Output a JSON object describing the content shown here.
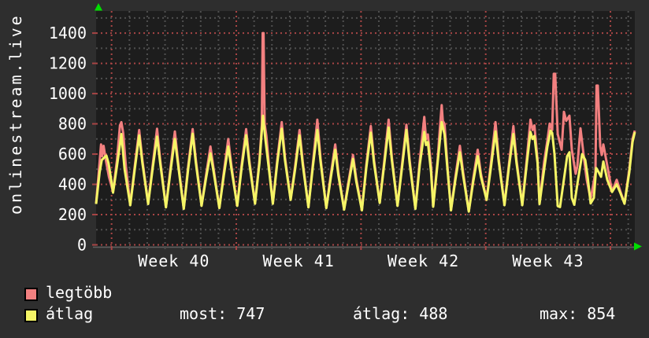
{
  "title": "onlinestream.live",
  "colors": {
    "background": "#2e2e2e",
    "plot_background": "#1d1d1d",
    "grid_major": "#a84545",
    "grid_minor": "#4f4f4f",
    "axis_line": "#606060",
    "arrow_green": "#00dd00",
    "text": "#ffffff",
    "series_max": "#f28080",
    "series_avg": "#f5f566",
    "swatch_border": "#000000"
  },
  "chart_data": {
    "type": "line",
    "title": "onlinestream.live",
    "x_axis": {
      "labels": [
        "Week 40",
        "Week 41",
        "Week 42",
        "Week 43"
      ],
      "unit": "days",
      "range_days": [
        0,
        30.24
      ],
      "week_major_ticks_days": [
        0.87,
        7.87,
        14.87,
        21.87,
        28.87
      ],
      "minor_tick_every_days": 1,
      "label_midpoints_days": [
        4.37,
        11.37,
        18.37,
        25.37
      ]
    },
    "y_axis": {
      "min": 0,
      "max": 1550,
      "major_step": 200,
      "minor_step": 100,
      "tick_labels": [
        0,
        200,
        400,
        600,
        800,
        1000,
        1200,
        1400
      ]
    },
    "grid": true,
    "legend_position": "bottom-left",
    "series": [
      {
        "name": "legtöbb",
        "color": "#f28080",
        "points": [
          [
            0,
            274
          ],
          [
            0.2,
            550
          ],
          [
            0.28,
            664
          ],
          [
            0.34,
            586
          ],
          [
            0.42,
            655
          ],
          [
            0.55,
            560
          ],
          [
            0.72,
            450
          ],
          [
            0.95,
            352
          ],
          [
            1.17,
            560
          ],
          [
            1.34,
            790
          ],
          [
            1.42,
            811
          ],
          [
            1.52,
            740
          ],
          [
            1.67,
            520
          ],
          [
            1.92,
            265
          ],
          [
            2.17,
            520
          ],
          [
            2.42,
            759
          ],
          [
            2.6,
            560
          ],
          [
            2.92,
            274
          ],
          [
            3.17,
            520
          ],
          [
            3.42,
            768
          ],
          [
            3.6,
            560
          ],
          [
            3.92,
            250
          ],
          [
            4.17,
            500
          ],
          [
            4.42,
            750
          ],
          [
            4.6,
            550
          ],
          [
            4.92,
            240
          ],
          [
            5.17,
            520
          ],
          [
            5.42,
            765
          ],
          [
            5.6,
            560
          ],
          [
            5.92,
            260
          ],
          [
            6.17,
            460
          ],
          [
            6.42,
            650
          ],
          [
            6.6,
            500
          ],
          [
            6.92,
            245
          ],
          [
            7.17,
            480
          ],
          [
            7.42,
            700
          ],
          [
            7.6,
            520
          ],
          [
            7.92,
            260
          ],
          [
            8.17,
            530
          ],
          [
            8.42,
            765
          ],
          [
            8.6,
            560
          ],
          [
            8.92,
            275
          ],
          [
            9.17,
            560
          ],
          [
            9.3,
            790
          ],
          [
            9.35,
            1400
          ],
          [
            9.4,
            1400
          ],
          [
            9.46,
            800
          ],
          [
            9.56,
            720
          ],
          [
            9.72,
            500
          ],
          [
            9.92,
            275
          ],
          [
            10.17,
            560
          ],
          [
            10.42,
            811
          ],
          [
            10.6,
            580
          ],
          [
            10.92,
            300
          ],
          [
            11.17,
            520
          ],
          [
            11.42,
            759
          ],
          [
            11.6,
            550
          ],
          [
            11.92,
            250
          ],
          [
            12.17,
            540
          ],
          [
            12.42,
            828
          ],
          [
            12.6,
            570
          ],
          [
            12.92,
            245
          ],
          [
            13.17,
            460
          ],
          [
            13.42,
            664
          ],
          [
            13.6,
            480
          ],
          [
            13.92,
            235
          ],
          [
            14.17,
            420
          ],
          [
            14.42,
            594
          ],
          [
            14.6,
            440
          ],
          [
            14.92,
            230
          ],
          [
            15.17,
            530
          ],
          [
            15.42,
            785
          ],
          [
            15.6,
            560
          ],
          [
            15.92,
            280
          ],
          [
            16.17,
            550
          ],
          [
            16.42,
            828
          ],
          [
            16.6,
            580
          ],
          [
            16.92,
            260
          ],
          [
            17.17,
            530
          ],
          [
            17.42,
            794
          ],
          [
            17.6,
            560
          ],
          [
            17.92,
            240
          ],
          [
            18.17,
            560
          ],
          [
            18.42,
            846
          ],
          [
            18.52,
            700
          ],
          [
            18.62,
            730
          ],
          [
            18.8,
            520
          ],
          [
            18.92,
            255
          ],
          [
            19.17,
            560
          ],
          [
            19.3,
            780
          ],
          [
            19.4,
            924
          ],
          [
            19.46,
            820
          ],
          [
            19.56,
            800
          ],
          [
            19.72,
            520
          ],
          [
            19.92,
            230
          ],
          [
            20.17,
            450
          ],
          [
            20.42,
            655
          ],
          [
            20.6,
            480
          ],
          [
            20.92,
            222
          ],
          [
            21.17,
            440
          ],
          [
            21.42,
            629
          ],
          [
            21.6,
            470
          ],
          [
            21.92,
            300
          ],
          [
            22.17,
            550
          ],
          [
            22.42,
            811
          ],
          [
            22.6,
            570
          ],
          [
            22.92,
            265
          ],
          [
            23.17,
            530
          ],
          [
            23.42,
            785
          ],
          [
            23.6,
            560
          ],
          [
            23.92,
            265
          ],
          [
            24.17,
            560
          ],
          [
            24.38,
            828
          ],
          [
            24.5,
            760
          ],
          [
            24.6,
            790
          ],
          [
            24.78,
            560
          ],
          [
            24.89,
            276
          ],
          [
            25.15,
            550
          ],
          [
            25.33,
            690
          ],
          [
            25.46,
            802
          ],
          [
            25.6,
            760
          ],
          [
            25.69,
            1131
          ],
          [
            25.77,
            1131
          ],
          [
            25.91,
            733
          ],
          [
            26.13,
            629
          ],
          [
            26.26,
            880
          ],
          [
            26.39,
            820
          ],
          [
            26.57,
            854
          ],
          [
            26.7,
            629
          ],
          [
            26.92,
            470
          ],
          [
            27.01,
            520
          ],
          [
            27.19,
            770
          ],
          [
            27.41,
            550
          ],
          [
            27.54,
            430
          ],
          [
            27.76,
            300
          ],
          [
            28.03,
            480
          ],
          [
            28.09,
            1053
          ],
          [
            28.16,
            1053
          ],
          [
            28.3,
            650
          ],
          [
            28.38,
            594
          ],
          [
            28.47,
            664
          ],
          [
            28.69,
            525
          ],
          [
            28.96,
            352
          ],
          [
            29.22,
            430
          ],
          [
            29.44,
            350
          ],
          [
            29.66,
            274
          ],
          [
            29.93,
            500
          ],
          [
            30.11,
            700
          ],
          [
            30.24,
            755
          ]
        ]
      },
      {
        "name": "átlag",
        "color": "#f5f566",
        "points": [
          [
            0,
            270
          ],
          [
            0.2,
            480
          ],
          [
            0.32,
            560
          ],
          [
            0.45,
            577
          ],
          [
            0.58,
            590
          ],
          [
            0.7,
            540
          ],
          [
            0.85,
            430
          ],
          [
            0.95,
            345
          ],
          [
            1.17,
            520
          ],
          [
            1.42,
            733
          ],
          [
            1.6,
            500
          ],
          [
            1.92,
            262
          ],
          [
            2.17,
            500
          ],
          [
            2.42,
            724
          ],
          [
            2.6,
            540
          ],
          [
            2.92,
            270
          ],
          [
            3.17,
            500
          ],
          [
            3.42,
            716
          ],
          [
            3.6,
            540
          ],
          [
            3.92,
            248
          ],
          [
            4.17,
            480
          ],
          [
            4.42,
            700
          ],
          [
            4.6,
            530
          ],
          [
            4.92,
            238
          ],
          [
            5.17,
            500
          ],
          [
            5.42,
            735
          ],
          [
            5.6,
            540
          ],
          [
            5.92,
            258
          ],
          [
            6.17,
            440
          ],
          [
            6.42,
            605
          ],
          [
            6.6,
            480
          ],
          [
            6.92,
            243
          ],
          [
            7.17,
            460
          ],
          [
            7.42,
            650
          ],
          [
            7.6,
            500
          ],
          [
            7.92,
            258
          ],
          [
            8.17,
            510
          ],
          [
            8.42,
            725
          ],
          [
            8.6,
            540
          ],
          [
            8.92,
            272
          ],
          [
            9.17,
            540
          ],
          [
            9.37,
            854
          ],
          [
            9.5,
            700
          ],
          [
            9.72,
            480
          ],
          [
            9.92,
            272
          ],
          [
            10.17,
            540
          ],
          [
            10.42,
            768
          ],
          [
            10.6,
            560
          ],
          [
            10.92,
            297
          ],
          [
            11.17,
            500
          ],
          [
            11.42,
            724
          ],
          [
            11.6,
            530
          ],
          [
            11.92,
            248
          ],
          [
            12.17,
            520
          ],
          [
            12.42,
            759
          ],
          [
            12.6,
            550
          ],
          [
            12.92,
            243
          ],
          [
            13.17,
            440
          ],
          [
            13.42,
            629
          ],
          [
            13.6,
            460
          ],
          [
            13.92,
            233
          ],
          [
            14.17,
            400
          ],
          [
            14.42,
            568
          ],
          [
            14.6,
            420
          ],
          [
            14.92,
            228
          ],
          [
            15.17,
            510
          ],
          [
            15.42,
            742
          ],
          [
            15.6,
            540
          ],
          [
            15.92,
            277
          ],
          [
            16.17,
            530
          ],
          [
            16.42,
            776
          ],
          [
            16.6,
            560
          ],
          [
            16.92,
            258
          ],
          [
            17.17,
            510
          ],
          [
            17.42,
            759
          ],
          [
            17.6,
            540
          ],
          [
            17.92,
            238
          ],
          [
            18.17,
            530
          ],
          [
            18.42,
            747
          ],
          [
            18.52,
            660
          ],
          [
            18.62,
            680
          ],
          [
            18.8,
            480
          ],
          [
            18.92,
            252
          ],
          [
            19.17,
            540
          ],
          [
            19.4,
            811
          ],
          [
            19.56,
            730
          ],
          [
            19.72,
            500
          ],
          [
            19.92,
            228
          ],
          [
            20.17,
            430
          ],
          [
            20.42,
            612
          ],
          [
            20.6,
            460
          ],
          [
            20.92,
            220
          ],
          [
            21.17,
            420
          ],
          [
            21.42,
            586
          ],
          [
            21.6,
            450
          ],
          [
            21.92,
            297
          ],
          [
            22.17,
            520
          ],
          [
            22.42,
            750
          ],
          [
            22.6,
            550
          ],
          [
            22.92,
            262
          ],
          [
            23.17,
            510
          ],
          [
            23.42,
            733
          ],
          [
            23.6,
            540
          ],
          [
            23.92,
            262
          ],
          [
            24.17,
            530
          ],
          [
            24.38,
            747
          ],
          [
            24.5,
            700
          ],
          [
            24.6,
            720
          ],
          [
            24.78,
            540
          ],
          [
            24.89,
            270
          ],
          [
            25.15,
            500
          ],
          [
            25.33,
            650
          ],
          [
            25.51,
            755
          ],
          [
            25.6,
            740
          ],
          [
            25.73,
            600
          ],
          [
            25.91,
            256
          ],
          [
            26.04,
            250
          ],
          [
            26.22,
            400
          ],
          [
            26.44,
            586
          ],
          [
            26.57,
            612
          ],
          [
            26.7,
            310
          ],
          [
            26.84,
            265
          ],
          [
            27.01,
            400
          ],
          [
            27.28,
            600
          ],
          [
            27.46,
            560
          ],
          [
            27.59,
            450
          ],
          [
            27.76,
            274
          ],
          [
            27.94,
            310
          ],
          [
            28.07,
            508
          ],
          [
            28.21,
            480
          ],
          [
            28.34,
            450
          ],
          [
            28.47,
            551
          ],
          [
            28.69,
            430
          ],
          [
            28.96,
            350
          ],
          [
            29.22,
            400
          ],
          [
            29.44,
            340
          ],
          [
            29.66,
            272
          ],
          [
            29.93,
            480
          ],
          [
            30.11,
            680
          ],
          [
            30.24,
            745
          ]
        ]
      }
    ]
  },
  "legend": {
    "items": [
      {
        "label": "legtöbb",
        "color": "#f28080"
      },
      {
        "label": "átlag",
        "color": "#f5f566"
      }
    ]
  },
  "footer_stats": [
    {
      "text": "most: 747"
    },
    {
      "text": "átlag: 488"
    },
    {
      "text": "max: 854"
    }
  ]
}
